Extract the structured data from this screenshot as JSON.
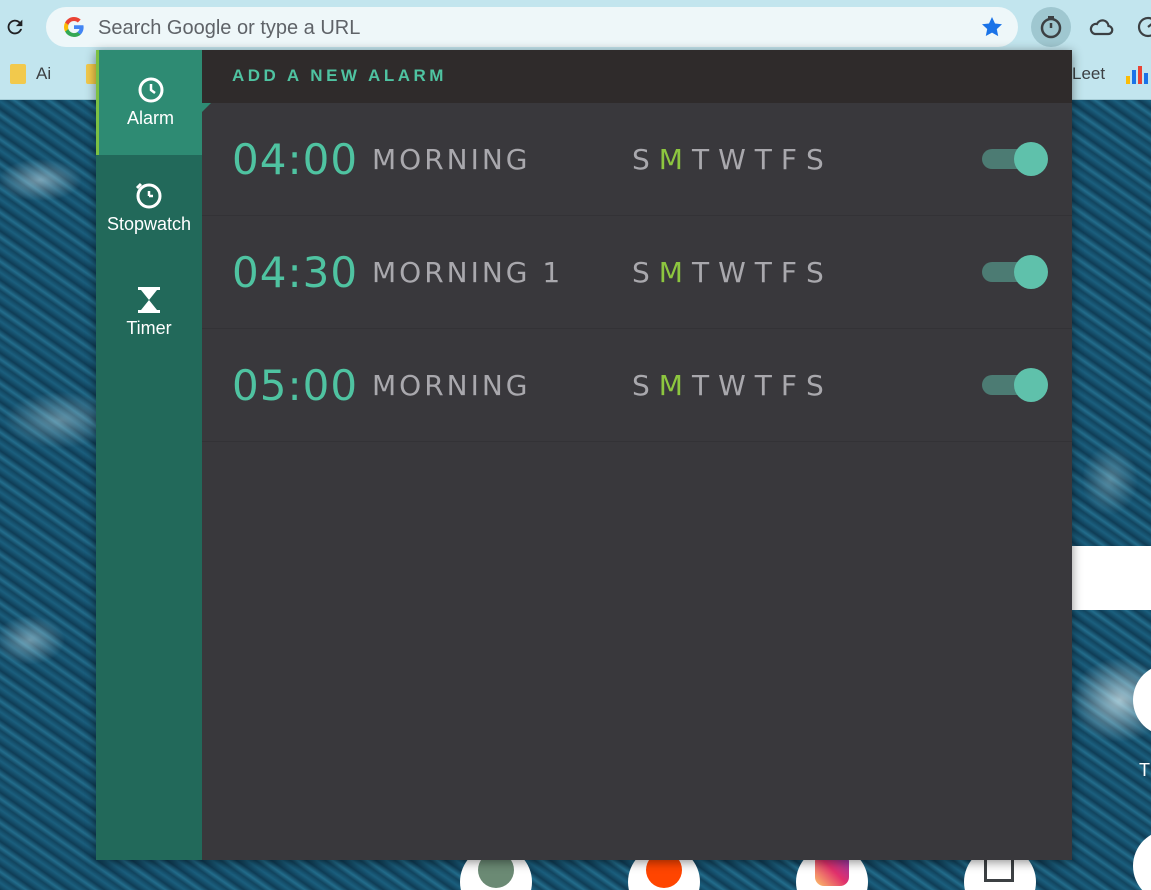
{
  "browser": {
    "omnibox_placeholder": "Search Google or type a URL",
    "bookmarks": [
      {
        "label": "Ai"
      },
      {
        "label": "Leet"
      }
    ]
  },
  "page": {
    "right_fragment_letter": "T"
  },
  "popup": {
    "nav": [
      {
        "label": "Alarm",
        "icon": "clock-icon",
        "active": true
      },
      {
        "label": "Stopwatch",
        "icon": "stopwatch-icon",
        "active": false
      },
      {
        "label": "Timer",
        "icon": "hourglass-icon",
        "active": false
      }
    ],
    "add_alarm_label": "ADD A NEW ALARM",
    "alarms": [
      {
        "time": "04:00",
        "label": "MORNING",
        "days": [
          "S",
          "M",
          "T",
          "W",
          "T",
          "F",
          "S"
        ],
        "active_days": [
          1
        ],
        "enabled": true
      },
      {
        "time": "04:30",
        "label": "MORNING 1",
        "days": [
          "S",
          "M",
          "T",
          "W",
          "T",
          "F",
          "S"
        ],
        "active_days": [
          1
        ],
        "enabled": true
      },
      {
        "time": "05:00",
        "label": "MORNING",
        "days": [
          "S",
          "M",
          "T",
          "W",
          "T",
          "F",
          "S"
        ],
        "active_days": [
          1
        ],
        "enabled": true
      }
    ]
  },
  "colors": {
    "accent_green": "#4fc3a1",
    "active_day": "#8dc63f",
    "sidebar": "#22695a",
    "sidebar_active": "#2e8b73",
    "panel": "#39383c"
  }
}
